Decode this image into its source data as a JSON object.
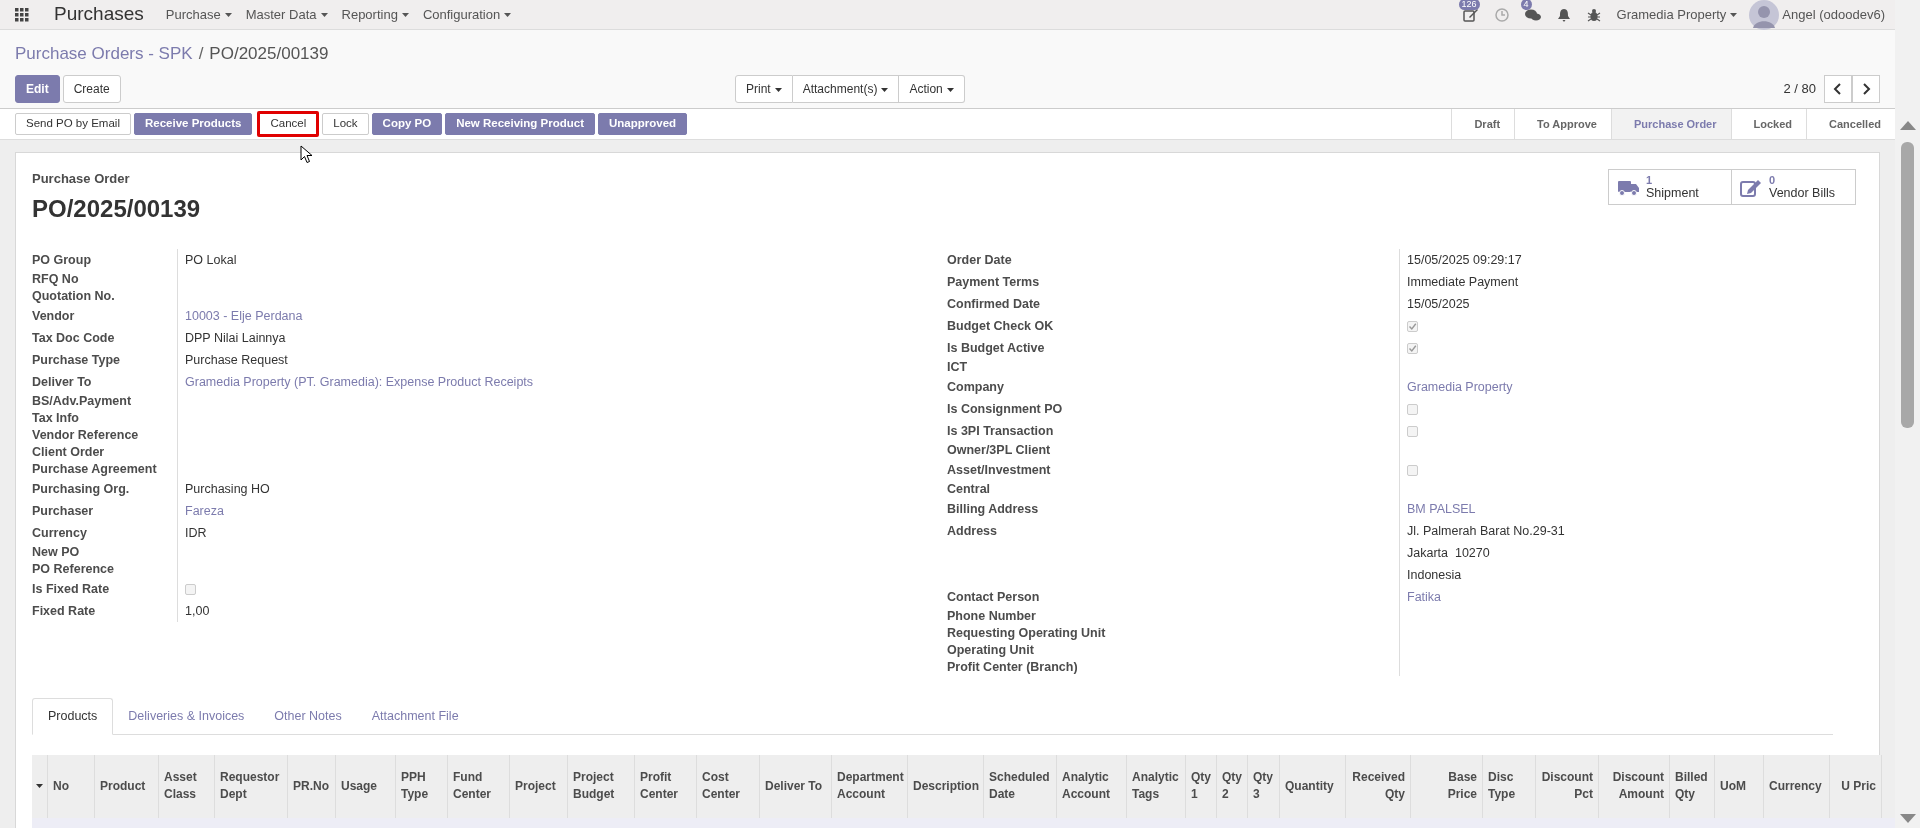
{
  "navbar": {
    "app": "Purchases",
    "menus": [
      "Purchase",
      "Master Data",
      "Reporting",
      "Configuration"
    ],
    "activity_badge": "126",
    "message_badge": "4",
    "company": "Gramedia Property",
    "user": "Angel (odoodev6)"
  },
  "breadcrumb": {
    "parent": "Purchase Orders - SPK",
    "separator": "/",
    "current": "PO/2025/00139"
  },
  "control_buttons": [
    {
      "label": "Edit",
      "primary": true
    },
    {
      "label": "Create",
      "primary": false
    }
  ],
  "action_menus": [
    "Print",
    "Attachment(s)",
    "Action"
  ],
  "pager": "2 / 80",
  "header_buttons": [
    {
      "label": "Send PO by Email",
      "primary": false,
      "highlighted": false
    },
    {
      "label": "Receive Products",
      "primary": true,
      "highlighted": false
    },
    {
      "label": "Cancel",
      "primary": false,
      "highlighted": true
    },
    {
      "label": "Lock",
      "primary": false,
      "highlighted": false
    },
    {
      "label": "Copy PO",
      "primary": true,
      "highlighted": false
    },
    {
      "label": "New Receiving Product",
      "primary": true,
      "highlighted": false
    },
    {
      "label": "Unapproved",
      "primary": true,
      "highlighted": false
    }
  ],
  "statusbar": [
    {
      "label": "Draft",
      "selected": false
    },
    {
      "label": "To Approve",
      "selected": false
    },
    {
      "label": "Purchase Order",
      "selected": true
    },
    {
      "label": "Locked",
      "selected": false
    },
    {
      "label": "Cancelled",
      "selected": false
    }
  ],
  "sheet": {
    "smart_buttons": [
      {
        "count": "1",
        "label": "Shipment"
      },
      {
        "count": "0",
        "label": "Vendor Bills"
      }
    ],
    "subtitle": "Purchase Order",
    "title": "PO/2025/00139",
    "left_fields": [
      {
        "label": "PO Group",
        "kind": "text",
        "value": "PO Lokal"
      },
      {
        "label": "RFQ No",
        "kind": "empty"
      },
      {
        "label": "Quotation No.",
        "kind": "empty"
      },
      {
        "label": "Vendor",
        "kind": "link",
        "value": "10003 - Elje Perdana"
      },
      {
        "label": "Tax Doc Code",
        "kind": "text",
        "value": "DPP Nilai Lainnya"
      },
      {
        "label": "Purchase Type",
        "kind": "text",
        "value": "Purchase Request"
      },
      {
        "label": "Deliver To",
        "kind": "link",
        "value": "Gramedia Property (PT. Gramedia): Expense Product Receipts"
      },
      {
        "label": "BS/Adv.Payment",
        "kind": "empty"
      },
      {
        "label": "Tax Info",
        "kind": "empty"
      },
      {
        "label": "Vendor Reference",
        "kind": "empty"
      },
      {
        "label": "Client Order",
        "kind": "empty"
      },
      {
        "label": "Purchase Agreement",
        "kind": "empty"
      },
      {
        "label": "Purchasing Org.",
        "kind": "text",
        "value": "Purchasing HO"
      },
      {
        "label": "Purchaser",
        "kind": "link",
        "value": "Fareza"
      },
      {
        "label": "Currency",
        "kind": "text",
        "value": "IDR"
      },
      {
        "label": "New PO",
        "kind": "empty"
      },
      {
        "label": "PO Reference",
        "kind": "empty"
      },
      {
        "label": "Is Fixed Rate",
        "kind": "checkbox",
        "checked": false
      },
      {
        "label": "Fixed Rate",
        "kind": "text",
        "value": "1,00"
      }
    ],
    "right_fields": [
      {
        "label": "Order Date",
        "kind": "text",
        "value": "15/05/2025 09:29:17"
      },
      {
        "label": "Payment Terms",
        "kind": "text",
        "value": "Immediate Payment"
      },
      {
        "label": "Confirmed Date",
        "kind": "text",
        "value": "15/05/2025"
      },
      {
        "label": "Budget Check OK",
        "kind": "checkbox",
        "checked": true
      },
      {
        "label": "Is Budget Active",
        "kind": "checkbox",
        "checked": true
      },
      {
        "label": "ICT",
        "kind": "empty"
      },
      {
        "label": "Company",
        "kind": "link",
        "value": "Gramedia Property"
      },
      {
        "label": "Is Consignment PO",
        "kind": "checkbox",
        "checked": false
      },
      {
        "label": "Is 3PI Transaction",
        "kind": "checkbox",
        "checked": false
      },
      {
        "label": "Owner/3PL Client",
        "kind": "empty"
      },
      {
        "label": "Asset/Investment",
        "kind": "checkbox",
        "checked": false
      },
      {
        "label": "Central",
        "kind": "empty"
      },
      {
        "label": "Billing Address",
        "kind": "link",
        "value": "BM PALSEL"
      },
      {
        "label": "Address",
        "kind": "lines",
        "lines": [
          "Jl. Palmerah Barat No.29-31",
          "Jakarta  10270",
          "Indonesia"
        ]
      },
      {
        "label": "Contact Person",
        "kind": "link",
        "value": "Fatika"
      },
      {
        "label": "Phone Number",
        "kind": "empty"
      },
      {
        "label": "Requesting Operating Unit",
        "kind": "empty"
      },
      {
        "label": "Operating Unit",
        "kind": "empty"
      },
      {
        "label": "Profit Center (Branch)",
        "kind": "empty"
      }
    ]
  },
  "tabs": [
    {
      "label": "Products",
      "selected": true
    },
    {
      "label": "Deliveries & Invoices",
      "selected": false
    },
    {
      "label": "Other Notes",
      "selected": false
    },
    {
      "label": "Attachment File",
      "selected": false
    }
  ],
  "table": {
    "columns": [
      {
        "label": "No",
        "numeric": false
      },
      {
        "label": "Product",
        "numeric": false
      },
      {
        "label": "Asset Class",
        "numeric": false
      },
      {
        "label": "Requestor Dept",
        "numeric": false
      },
      {
        "label": "PR.No",
        "numeric": false
      },
      {
        "label": "Usage",
        "numeric": false
      },
      {
        "label": "PPH Type",
        "numeric": false
      },
      {
        "label": "Fund Center",
        "numeric": false
      },
      {
        "label": "Project",
        "numeric": false
      },
      {
        "label": "Project Budget",
        "numeric": false
      },
      {
        "label": "Profit Center",
        "numeric": false
      },
      {
        "label": "Cost Center",
        "numeric": false
      },
      {
        "label": "Deliver To",
        "numeric": false
      },
      {
        "label": "Department Account",
        "numeric": false
      },
      {
        "label": "Description",
        "numeric": false
      },
      {
        "label": "Scheduled Date",
        "numeric": false
      },
      {
        "label": "Analytic Account",
        "numeric": false
      },
      {
        "label": "Analytic Tags",
        "numeric": false
      },
      {
        "label": "Qty 1",
        "numeric": false
      },
      {
        "label": "Qty 2",
        "numeric": false
      },
      {
        "label": "Qty 3",
        "numeric": false
      },
      {
        "label": "Quantity",
        "numeric": false
      },
      {
        "label": "Received Qty",
        "numeric": true
      },
      {
        "label": "Base Price",
        "numeric": true
      },
      {
        "label": "Disc Type",
        "numeric": false
      },
      {
        "label": "Discount Pct",
        "numeric": true
      },
      {
        "label": "Discount Amount",
        "numeric": true
      },
      {
        "label": "Billed Qty",
        "numeric": false
      },
      {
        "label": "UoM",
        "numeric": false
      },
      {
        "label": "Currency",
        "numeric": false
      },
      {
        "label": "U Pric",
        "numeric": true
      }
    ]
  }
}
